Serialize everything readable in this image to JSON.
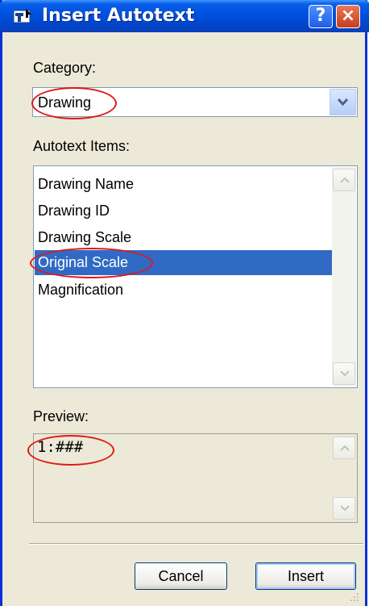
{
  "window": {
    "title": "Insert Autotext",
    "help_label": "?",
    "close_label": "×"
  },
  "category": {
    "label": "Category:",
    "value": "Drawing"
  },
  "autotext": {
    "label": "Autotext Items:",
    "items": [
      "Drawing Name",
      "Drawing ID",
      "Drawing Scale",
      "Original Scale",
      "Magnification"
    ],
    "selected_index": 3
  },
  "preview": {
    "label": "Preview:",
    "value": "1:###"
  },
  "buttons": {
    "cancel": "Cancel",
    "insert": "Insert"
  },
  "colors": {
    "accent": "#0054e3",
    "selection": "#316ac5",
    "annotation": "#e01818",
    "face": "#ece9d8"
  },
  "icons": {
    "window": "window-app-icon",
    "dropdown": "chevron-down-icon",
    "scroll_up": "scroll-up-icon",
    "scroll_down": "scroll-down-icon"
  }
}
